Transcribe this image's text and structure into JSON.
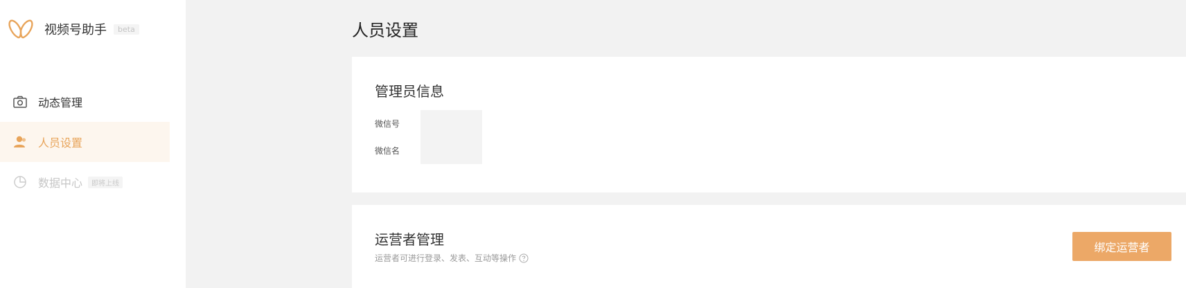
{
  "app": {
    "name": "视频号助手",
    "badge": "beta"
  },
  "sidebar": {
    "items": [
      {
        "label": "动态管理",
        "icon": "camera-icon",
        "state": "normal"
      },
      {
        "label": "人员设置",
        "icon": "user-icon",
        "state": "active"
      },
      {
        "label": "数据中心",
        "icon": "pie-chart-icon",
        "state": "disabled",
        "tag": "即将上线"
      }
    ]
  },
  "main": {
    "page_title": "人员设置",
    "admin_card": {
      "title": "管理员信息",
      "fields": [
        {
          "label": "微信号",
          "value": ""
        },
        {
          "label": "微信名",
          "value": ""
        }
      ]
    },
    "operator_card": {
      "title": "运营者管理",
      "description": "运营者可进行登录、发表、互动等操作",
      "bind_button_label": "绑定运营者"
    }
  },
  "colors": {
    "accent": "#eca867",
    "active_bg": "#fdf6ee",
    "active_text": "#e8a45a",
    "page_bg": "#f2f2f2"
  }
}
